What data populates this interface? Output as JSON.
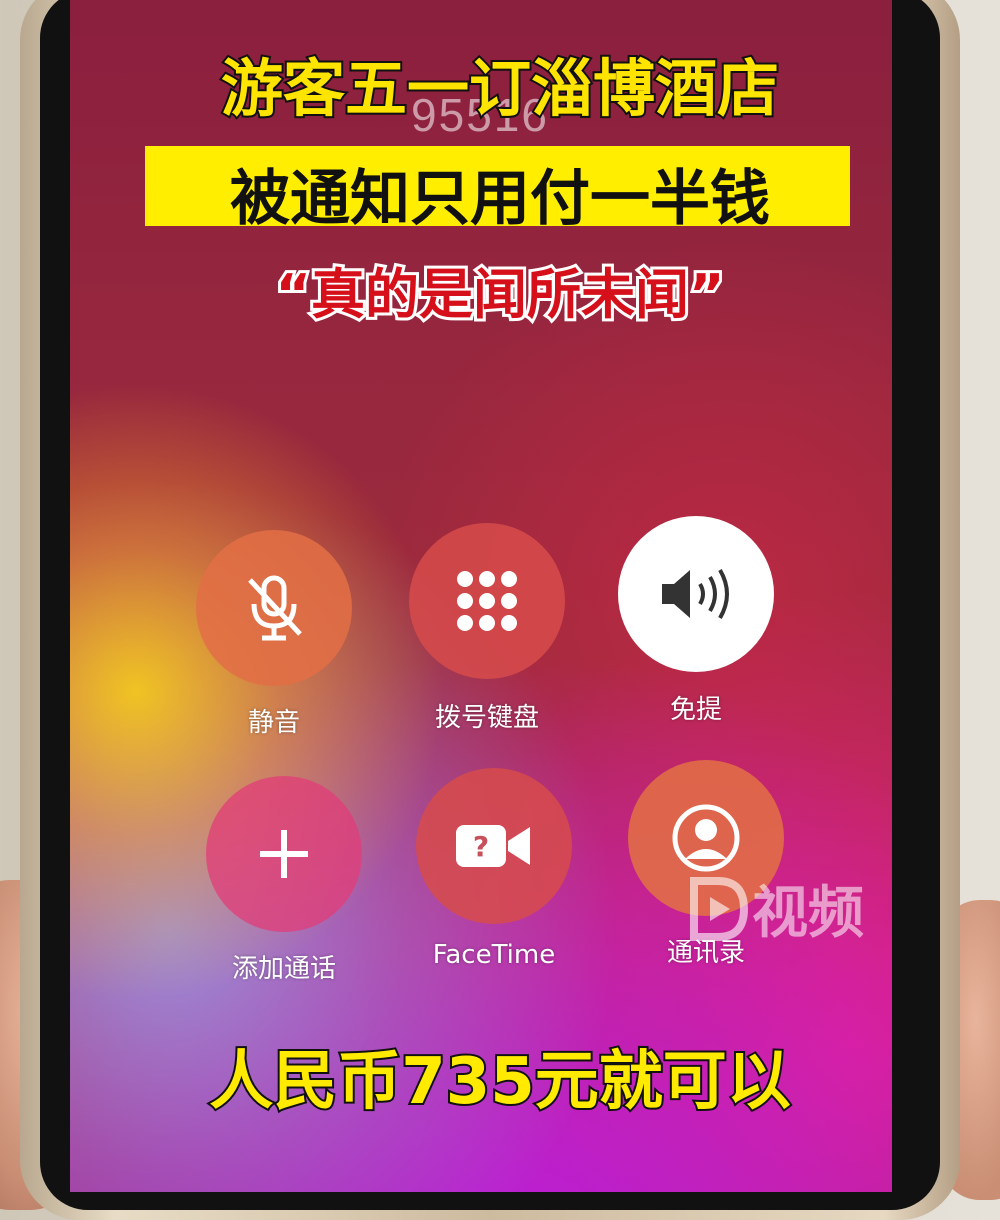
{
  "screen": {
    "dialed_number": "95516",
    "overlay": {
      "line1": "游客五一订淄博酒店",
      "line2": "被通知只用付一半钱",
      "line3": "“真的是闻所未闻”",
      "bottom": "人民币735元就可以"
    },
    "call_controls": [
      {
        "label": "静音",
        "icon": "mic-off-icon"
      },
      {
        "label": "拨号键盘",
        "icon": "keypad-icon"
      },
      {
        "label": "免提",
        "icon": "speaker-icon",
        "active": true
      },
      {
        "label": "添加通话",
        "icon": "plus-icon"
      },
      {
        "label": "FaceTime",
        "icon": "facetime-icon"
      },
      {
        "label": "通讯录",
        "icon": "contacts-icon"
      }
    ],
    "watermark": "视频",
    "colors": {
      "caption_yellow": "#ffe400",
      "quote_red": "#d6101a",
      "speaker_active": "#ffffff"
    }
  }
}
